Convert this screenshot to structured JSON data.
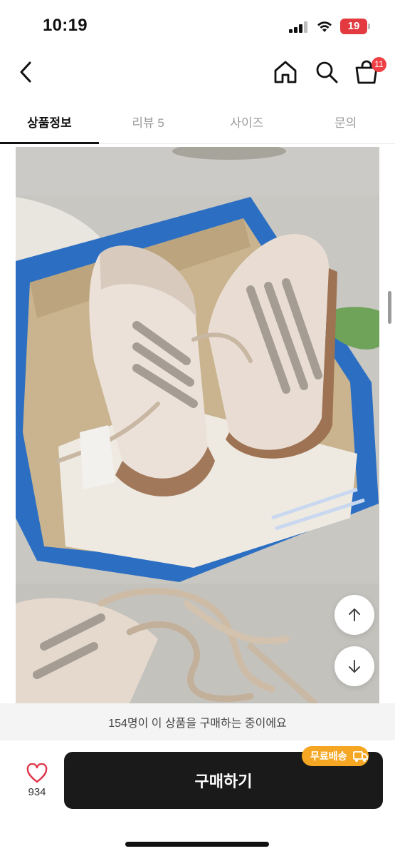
{
  "status": {
    "time": "10:19",
    "battery": "19",
    "battery_color": "#e23a3f"
  },
  "header": {
    "back_icon": "chevron-left-icon",
    "home_icon": "home-icon",
    "search_icon": "search-icon",
    "cart_icon": "shopping-bag-icon",
    "cart_count": "11"
  },
  "tabs": [
    {
      "label": "상품정보",
      "active": true
    },
    {
      "label": "리뷰 5",
      "active": false
    },
    {
      "label": "사이즈",
      "active": false
    },
    {
      "label": "문의",
      "active": false
    }
  ],
  "product_image": {
    "alt": "adidas"
  },
  "scroll_buttons": {
    "up_icon": "arrow-up-icon",
    "down_icon": "arrow-down-icon"
  },
  "bottom": {
    "viewer_text": "154명이 이 상품을 구매하는 중이에요",
    "like_count": "934",
    "like_icon": "heart-icon",
    "buy_label": "구매하기",
    "shipping_badge": "무료배송",
    "shipping_icon": "truck-icon",
    "accent_color": "#f5a623"
  }
}
